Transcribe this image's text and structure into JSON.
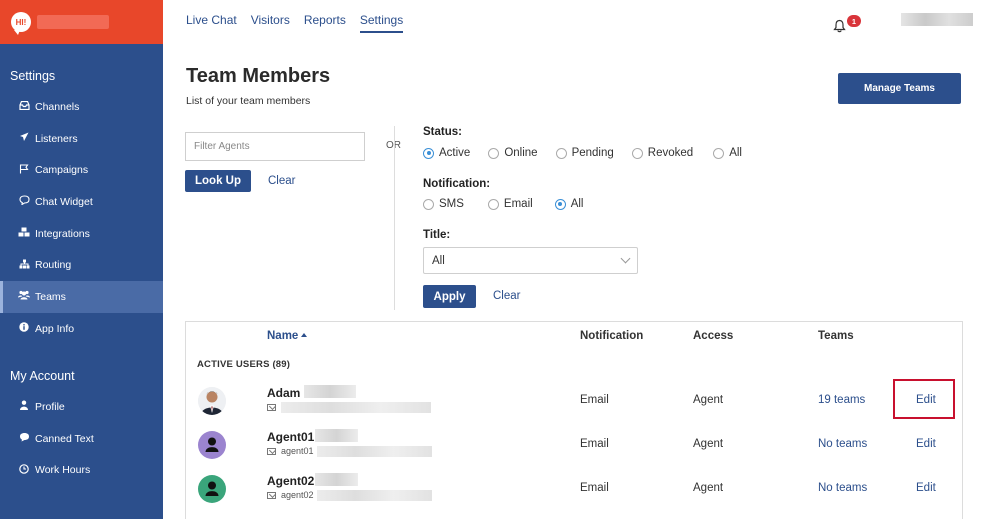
{
  "sidebar": {
    "section_settings": "Settings",
    "settings_items": [
      {
        "label": "Channels",
        "icon": "inbox-icon"
      },
      {
        "label": "Listeners",
        "icon": "rocket-icon"
      },
      {
        "label": "Campaigns",
        "icon": "flag-icon"
      },
      {
        "label": "Chat Widget",
        "icon": "chat-bubble-icon"
      },
      {
        "label": "Integrations",
        "icon": "cubes-icon"
      },
      {
        "label": "Routing",
        "icon": "sitemap-icon"
      },
      {
        "label": "Teams",
        "icon": "users-icon",
        "active": true
      },
      {
        "label": "App Info",
        "icon": "info-icon"
      }
    ],
    "section_account": "My Account",
    "account_items": [
      {
        "label": "Profile",
        "icon": "user-icon"
      },
      {
        "label": "Canned Text",
        "icon": "comment-icon"
      },
      {
        "label": "Work Hours",
        "icon": "clock-icon"
      }
    ]
  },
  "brand": {
    "logo_text": "HI!"
  },
  "nav": {
    "items": [
      "Live Chat",
      "Visitors",
      "Reports",
      "Settings"
    ],
    "active": "Settings",
    "notification_count": "1"
  },
  "header": {
    "title": "Team Members",
    "subtitle": "List of your team members",
    "manage_button": "Manage Teams"
  },
  "filters": {
    "agent_placeholder": "Filter Agents",
    "lookup_button": "Look Up",
    "clear_label": "Clear",
    "or_label": "OR",
    "status_label": "Status:",
    "status_options": [
      "Active",
      "Online",
      "Pending",
      "Revoked",
      "All"
    ],
    "status_selected": "Active",
    "notification_label": "Notification:",
    "notification_options": [
      "SMS",
      "Email",
      "All"
    ],
    "notification_selected": "All",
    "title_label": "Title:",
    "title_value": "All",
    "apply_button": "Apply",
    "apply_clear_label": "Clear"
  },
  "table": {
    "columns": {
      "name": "Name",
      "notification": "Notification",
      "access": "Access",
      "teams": "Teams"
    },
    "group_label": "ACTIVE USERS (89)",
    "rows": [
      {
        "name": "Adam",
        "email": "",
        "notification": "Email",
        "access": "Agent",
        "teams": "19 teams",
        "edit": "Edit",
        "avatar": "photo"
      },
      {
        "name": "Agent01",
        "email": "agent01",
        "notification": "Email",
        "access": "Agent",
        "teams": "No teams",
        "edit": "Edit",
        "avatar": "purple"
      },
      {
        "name": "Agent02",
        "email": "agent02",
        "notification": "Email",
        "access": "Agent",
        "teams": "No teams",
        "edit": "Edit",
        "avatar": "green"
      }
    ]
  }
}
